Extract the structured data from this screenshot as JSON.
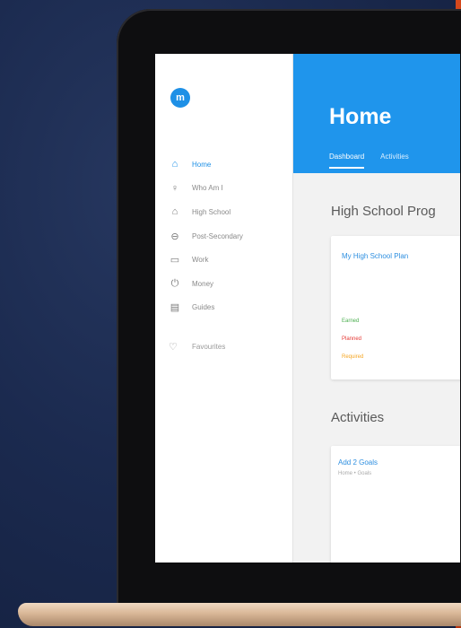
{
  "app": {
    "logo_letter": "m"
  },
  "sidebar": {
    "items": [
      {
        "label": "Home",
        "icon": "home-icon",
        "glyph": "⌂",
        "active": true
      },
      {
        "label": "Who Am I",
        "icon": "person-icon",
        "glyph": "♀",
        "active": false
      },
      {
        "label": "High School",
        "icon": "school-icon",
        "glyph": "⌂",
        "active": false
      },
      {
        "label": "Post-Secondary",
        "icon": "graduation-icon",
        "glyph": "⊖",
        "active": false
      },
      {
        "label": "Work",
        "icon": "briefcase-icon",
        "glyph": "▭",
        "active": false
      },
      {
        "label": "Money",
        "icon": "money-icon",
        "glyph": "⏻",
        "active": false
      },
      {
        "label": "Guides",
        "icon": "guide-icon",
        "glyph": "▤",
        "active": false
      }
    ],
    "favourites": {
      "label": "Favourites",
      "icon": "heart-icon"
    }
  },
  "header": {
    "title": "Home",
    "tabs": [
      {
        "label": "Dashboard",
        "active": true
      },
      {
        "label": "Activities",
        "active": false
      }
    ]
  },
  "main": {
    "high_school_section": {
      "title": "High School Prog",
      "card_title": "My High School Plan",
      "legend": [
        {
          "label": "Earned",
          "color": "#4caf50"
        },
        {
          "label": "Planned",
          "color": "#e53935"
        },
        {
          "label": "Required",
          "color": "#f5a623"
        }
      ]
    },
    "activities_section": {
      "title": "Activities",
      "card_title": "Add 2 Goals",
      "card_breadcrumb": "Home • Goals"
    }
  },
  "colors": {
    "accent": "#1f95ec",
    "sidebar_active": "#1e90e6"
  }
}
